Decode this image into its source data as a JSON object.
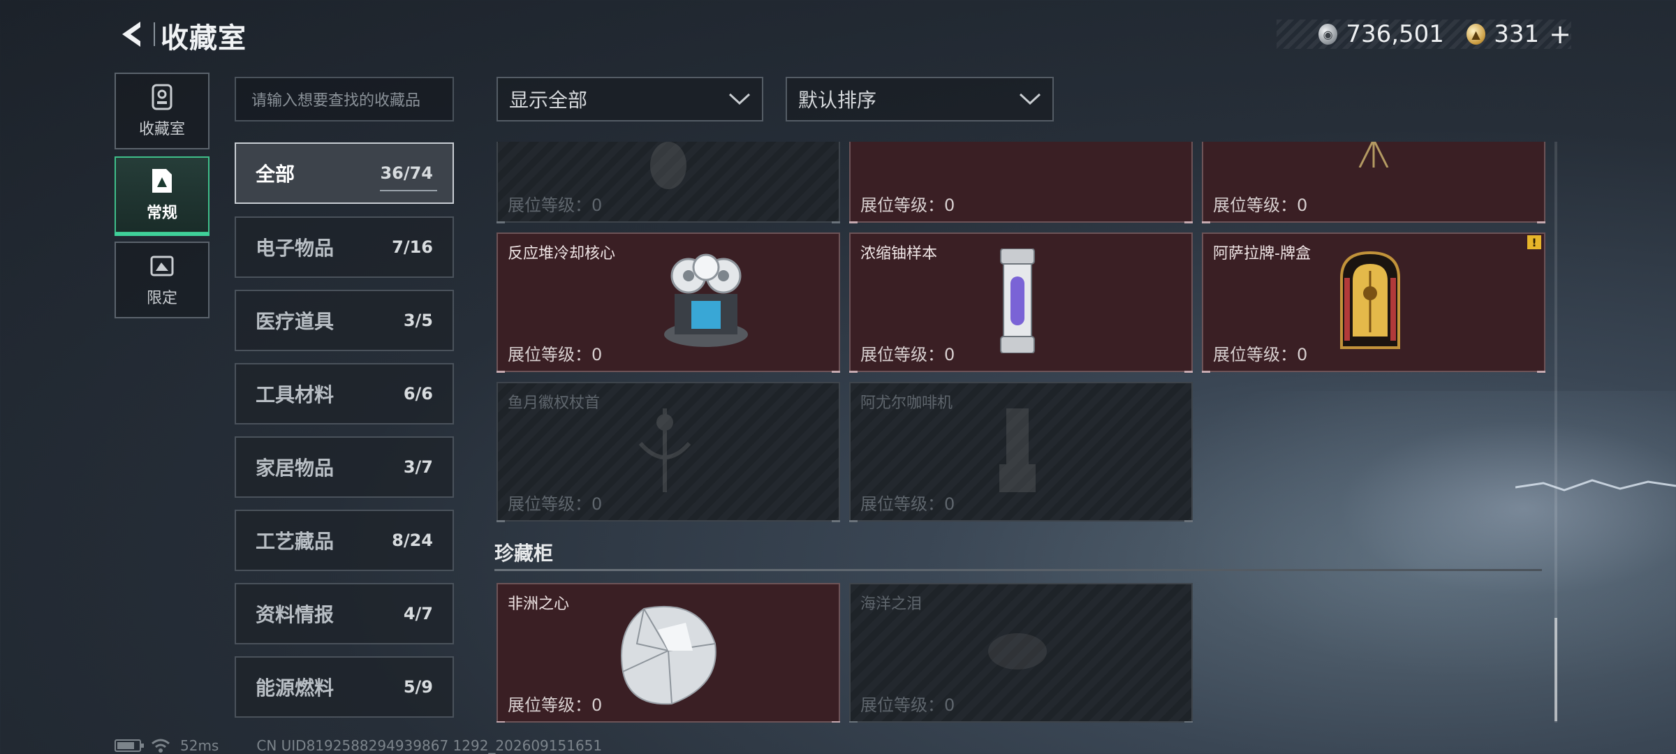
{
  "header": {
    "title": "收藏室",
    "currency": [
      {
        "icon": "silver-coin-icon",
        "value": "736,501"
      },
      {
        "icon": "gold-coin-icon",
        "value": "331"
      }
    ],
    "plus": "+"
  },
  "side_tabs": [
    {
      "label": "收藏室",
      "icon": "collection-room-icon",
      "active": false
    },
    {
      "label": "常规",
      "icon": "regular-icon",
      "active": true
    },
    {
      "label": "限定",
      "icon": "limited-icon",
      "active": false
    }
  ],
  "search": {
    "placeholder": "请输入想要查找的收藏品"
  },
  "categories": [
    {
      "name": "全部",
      "count": "36/74",
      "active": true
    },
    {
      "name": "电子物品",
      "count": "7/16"
    },
    {
      "name": "医疗道具",
      "count": "3/5"
    },
    {
      "name": "工具材料",
      "count": "6/6"
    },
    {
      "name": "家居物品",
      "count": "3/7"
    },
    {
      "name": "工艺藏品",
      "count": "8/24"
    },
    {
      "name": "资料情报",
      "count": "4/7"
    },
    {
      "name": "能源燃料",
      "count": "5/9"
    }
  ],
  "filters": {
    "display": "显示全部",
    "sort": "默认排序"
  },
  "cards": [
    {
      "name": "",
      "level": "展位等级：0",
      "locked": true,
      "icon": "golden-relic-icon"
    },
    {
      "name": "",
      "level": "展位等级：0",
      "locked": false,
      "icon": "metal-case-icon"
    },
    {
      "name": "",
      "level": "展位等级：0",
      "locked": false,
      "icon": "tripod-icon"
    },
    {
      "name": "反应堆冷却核心",
      "level": "展位等级：0",
      "locked": false,
      "icon": "reactor-core-icon"
    },
    {
      "name": "浓缩铀样本",
      "level": "展位等级：0",
      "locked": false,
      "icon": "uranium-capsule-icon"
    },
    {
      "name": "阿萨拉牌-牌盒",
      "level": "展位等级：0",
      "locked": false,
      "icon": "card-box-icon",
      "badge": "!"
    },
    {
      "name": "鱼月徽权杖首",
      "level": "展位等级：0",
      "locked": true,
      "icon": "scepter-head-icon"
    },
    {
      "name": "阿尤尔咖啡机",
      "level": "展位等级：0",
      "locked": true,
      "icon": "coffee-machine-icon"
    }
  ],
  "section": {
    "title": "珍藏柜"
  },
  "treasure_cards": [
    {
      "name": "非洲之心",
      "level": "展位等级：0",
      "locked": false,
      "icon": "diamond-icon"
    },
    {
      "name": "海洋之泪",
      "level": "展位等级：0",
      "locked": true,
      "icon": "ocean-gem-icon"
    }
  ],
  "footer": {
    "ping": "52ms",
    "uid": "CN UID8192588294939867 1292_202609151651"
  },
  "colors": {
    "accent_green": "#3fd19a",
    "owned_card_bg": "#3a1f24",
    "warning_badge": "#e7b52a"
  }
}
